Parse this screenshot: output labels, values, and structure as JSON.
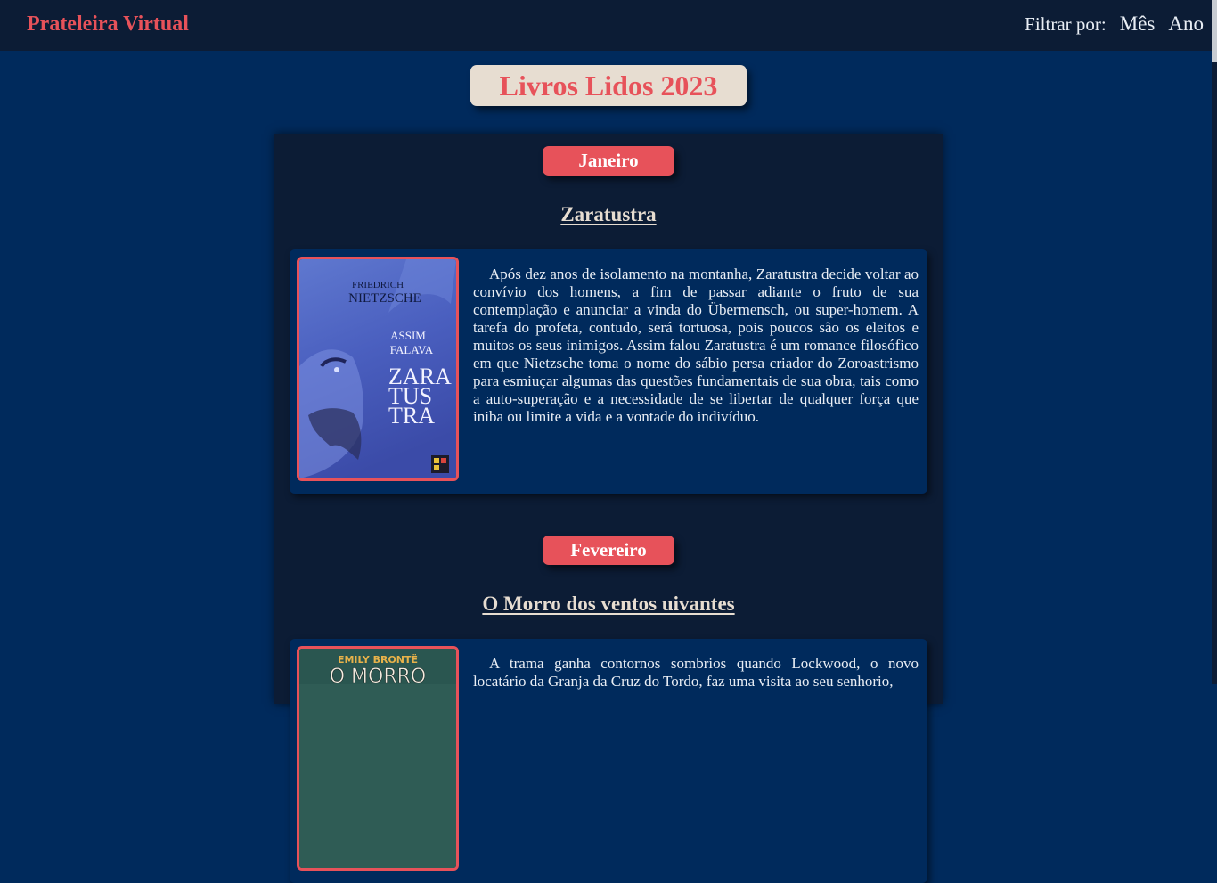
{
  "navbar": {
    "brand": "Prateleira Virtual",
    "filter_label": "Filtrar por:",
    "filter_month": "Mês",
    "filter_year": "Ano"
  },
  "page_title": "Livros Lidos 2023",
  "months": [
    {
      "name": "Janeiro",
      "book": {
        "title": "Zaratustra",
        "cover": {
          "author": "FRIEDRICH NIETZSCHE",
          "line1": "ASSIM",
          "line2": "FALAVA",
          "title_lines": [
            "ZARA",
            "TUS",
            "TRA"
          ]
        },
        "description": "Após dez anos de isolamento na montanha, Zaratustra decide voltar ao convívio dos homens, a fim de passar adiante o fruto de sua contemplação e anunciar a vinda do Übermensch, ou super-homem. A tarefa do profeta, contudo, será tortuosa, pois poucos são os eleitos e muitos os seus inimigos. Assim falou Zaratustra é um romance filosófico em que Nietzsche toma o nome do sábio persa criador do Zoroastrismo para esmiuçar algumas das questões fundamentais de sua obra, tais como a auto-superação e a necessidade de se libertar de qualquer força que iniba ou limite a vida e a vontade do indivíduo."
      }
    },
    {
      "name": "Fevereiro",
      "book": {
        "title": "O Morro dos ventos uivantes",
        "cover": {
          "author": "EMILY BRONTË",
          "title_top": "O MORRO"
        },
        "description": "A trama ganha contornos sombrios quando Lockwood, o novo locatário da Granja da Cruz do Tordo, faz uma visita ao seu senhorio,"
      }
    }
  ],
  "colors": {
    "accent": "#e7525a",
    "background": "#002a5c",
    "navbar": "#0c1c35",
    "panel": "#0c1c35",
    "title_box": "#e7ddd1"
  }
}
